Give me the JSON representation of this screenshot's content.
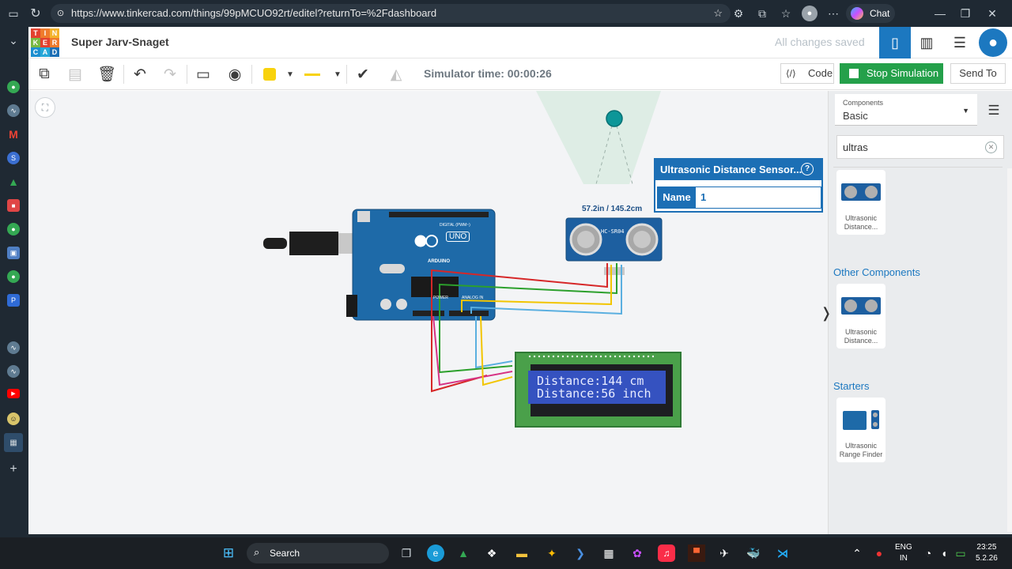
{
  "browser": {
    "url": "https://www.tinkercad.com/things/99pMCUO92rt/editel?returnTo=%2Fdashboard",
    "chat_label": "Chat"
  },
  "app": {
    "logo_letters": [
      "T",
      "I",
      "N",
      "K",
      "E",
      "R",
      "C",
      "A",
      "D"
    ],
    "project_title": "Super Jarv-Snaget",
    "save_status": "All changes saved"
  },
  "toolbar": {
    "simulator_time": "Simulator time: 00:00:26",
    "code_label": "Code",
    "stop_label": "Stop Simulation",
    "send_label": "Send To",
    "shape_color": "#f8d20c"
  },
  "properties": {
    "title": "Ultrasonic Distance Sensor...",
    "help": "?",
    "name_label": "Name",
    "name_value": "1"
  },
  "sensor": {
    "reading": "57.2in / 145.2cm",
    "model": "HC-SR04"
  },
  "arduino": {
    "brand": "ARDUINO",
    "model": "UNO",
    "digital_label": "DIGITAL (PWM~)",
    "power_label": "POWER",
    "analog_label": "ANALOG IN"
  },
  "lcd": {
    "line1": "Distance:144 cm",
    "line2": "Distance:56 inch"
  },
  "panel": {
    "components_caption": "Components",
    "components_value": "Basic",
    "search_value": "ultras",
    "basic_item": "Ultrasonic Distance...",
    "other_title": "Other Components",
    "other_item": "Ultrasonic Distance...",
    "starters_title": "Starters",
    "starter_item": "Ultrasonic Range Finder"
  },
  "taskbar": {
    "search_label": "Search",
    "lang_top": "ENG",
    "lang_bottom": "IN",
    "time": "23:25",
    "date": "5.2.26"
  }
}
